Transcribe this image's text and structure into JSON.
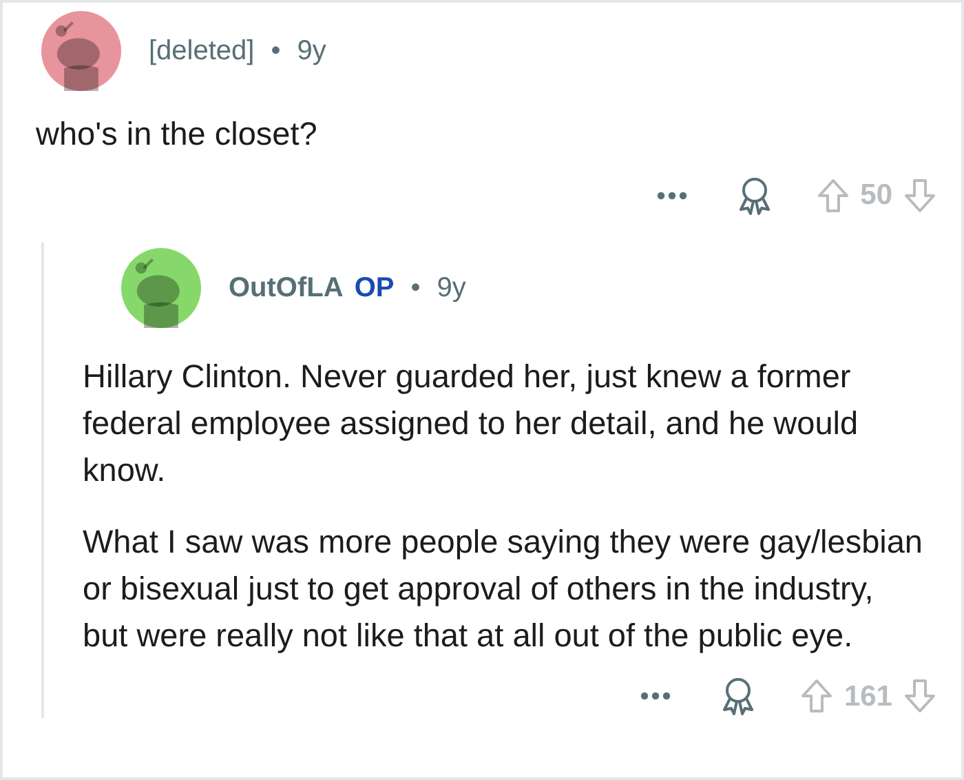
{
  "comments": [
    {
      "author": "[deleted]",
      "is_op": false,
      "separator": "•",
      "age": "9y",
      "color": "#e8949c",
      "paragraphs": [
        "who's in the closet?"
      ],
      "score": "50"
    },
    {
      "author": "OutOfLA",
      "is_op": true,
      "op_label": "OP",
      "separator": "•",
      "age": "9y",
      "color": "#86d86a",
      "paragraphs": [
        "Hillary Clinton. Never guarded her, just knew a former federal employee assigned to her detail, and he would know.",
        "What I saw was more people saying they were gay/lesbian or bisexual just to get approval of others in the industry, but were really not like that at all out of the public eye."
      ],
      "score": "161"
    }
  ]
}
